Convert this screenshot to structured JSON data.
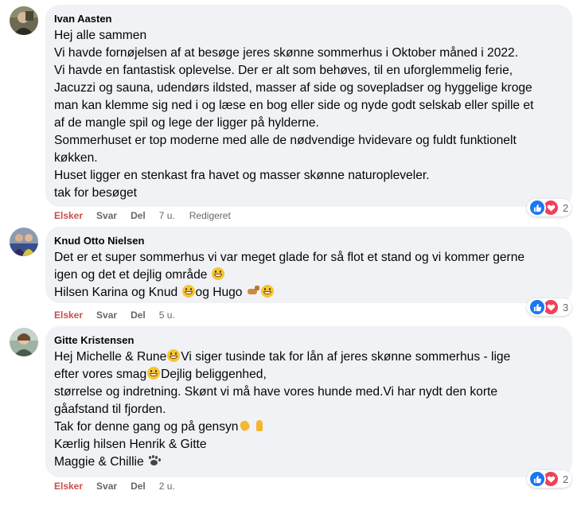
{
  "actions": {
    "like": "Elsker",
    "reply": "Svar",
    "share": "Del",
    "edited": "Redigeret"
  },
  "comments": [
    {
      "author": "Ivan Aasten",
      "lines": [
        "Hej alle sammen",
        "Vi havde fornøjelsen af at besøge jeres skønne sommerhus i Oktober måned i 2022.",
        "Vi havde en fantastisk oplevelse. Der er alt som behøves, til en uforglemmelig ferie,",
        "Jacuzzi og sauna, udendørs ildsted, masser af side og sovepladser og hyggelige kroge",
        "man kan klemme sig ned i og læse en bog eller side og nyde godt selskab eller spille et",
        "af de mangle spil og lege der ligger på hylderne.",
        "Sommerhuset er top moderne med alle de nødvendige hvidevare og fuldt funktionelt",
        "køkken.",
        "Huset ligger en stenkast fra havet og masser skønne naturopleveler.",
        "tak for besøget"
      ],
      "time": "7 u.",
      "reactions": 2
    },
    {
      "author": "Knud Otto Nielsen",
      "line1": "Det er et super sommerhus vi var meget glade for så flot et stand og vi kommer gerne",
      "line2": "igen og det et dejlig område",
      "line3a": "Hilsen Karina og Knud",
      "line3b": "og Hugo",
      "time": "5 u.",
      "reactions": 3
    },
    {
      "author": "Gitte Kristensen",
      "line1a": "Hej Michelle & Rune",
      "line1b": "Vi siger tusinde tak for lån af jeres skønne sommerhus - lige",
      "line2a": "efter vores smag",
      "line2b": "Dejlig beliggenhed,",
      "line3": "størrelse og indretning. Skønt vi må have vores hunde med.Vi har nydt den korte",
      "line4": "gåafstand til fjorden.",
      "line5": "Tak for denne gang og på gensyn",
      "line6": "Kærlig hilsen Henrik & Gitte",
      "line7": "Maggie & Chillie",
      "time": "2 u.",
      "reactions": 2
    }
  ],
  "colors": {
    "bubble": "#f0f2f5",
    "like_accent": "#c94e4f",
    "meta": "#65676b",
    "like_blue": "#1877f2",
    "heart_red": "#f33e58"
  }
}
